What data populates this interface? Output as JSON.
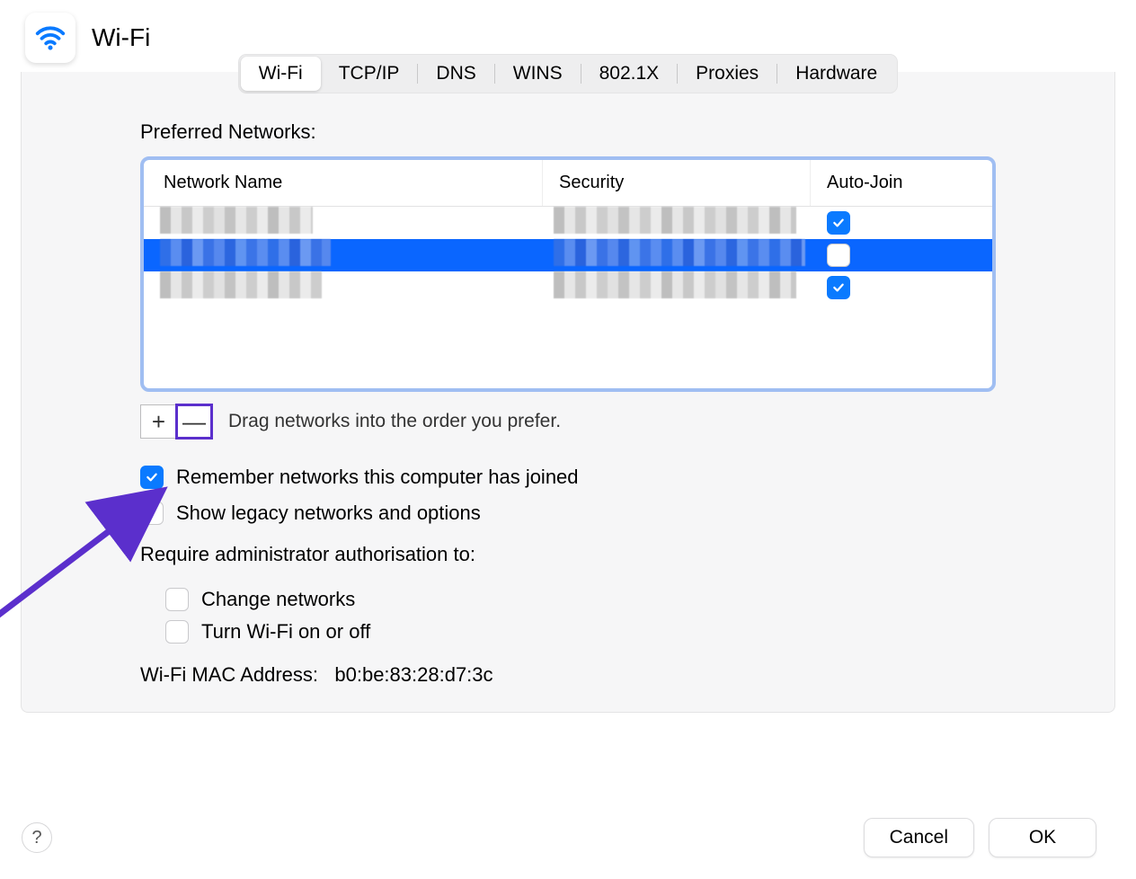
{
  "header": {
    "title": "Wi-Fi"
  },
  "tabs": {
    "items": [
      "Wi-Fi",
      "TCP/IP",
      "DNS",
      "WINS",
      "802.1X",
      "Proxies",
      "Hardware"
    ],
    "active_index": 0
  },
  "preferred_networks": {
    "label": "Preferred Networks:",
    "columns": {
      "name": "Network Name",
      "security": "Security",
      "auto_join": "Auto-Join"
    },
    "rows": [
      {
        "name": "[redacted]",
        "security": "[redacted]",
        "auto_join": true,
        "selected": false
      },
      {
        "name": "[redacted]",
        "security": "[redacted]",
        "auto_join": false,
        "selected": true
      },
      {
        "name": "[redacted]",
        "security": "[redacted]",
        "auto_join": true,
        "selected": false
      }
    ],
    "hint": "Drag networks into the order you prefer."
  },
  "options": {
    "remember": {
      "label": "Remember networks this computer has joined",
      "checked": true
    },
    "legacy": {
      "label": "Show legacy networks and options",
      "checked": false
    },
    "require_label": "Require administrator authorisation to:",
    "change_networks": {
      "label": "Change networks",
      "checked": false
    },
    "toggle_wifi": {
      "label": "Turn Wi-Fi on or off",
      "checked": false
    }
  },
  "mac": {
    "label": "Wi-Fi MAC Address:",
    "value": "b0:be:83:28:d7:3c"
  },
  "buttons": {
    "add": "+",
    "remove": "—",
    "help": "?",
    "cancel": "Cancel",
    "ok": "OK"
  }
}
